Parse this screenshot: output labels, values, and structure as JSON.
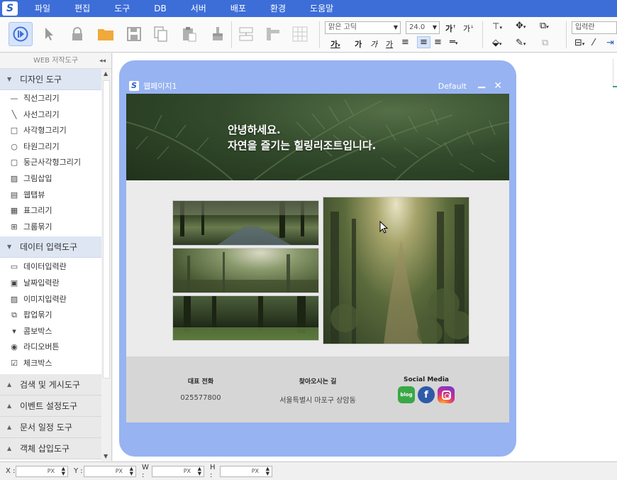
{
  "menubar": {
    "items": [
      "파일",
      "편집",
      "도구",
      "DB",
      "서버",
      "배포",
      "환경",
      "도움말"
    ]
  },
  "toolbar": {
    "font_name": "맑은 고딕",
    "font_size": "24.0",
    "input_label": "입력란"
  },
  "sidebar": {
    "title": "WEB 저작도구",
    "design_header": "디자인 도구",
    "design_items": [
      {
        "label": "직선그리기",
        "icon": "line-icon"
      },
      {
        "label": "사선그리기",
        "icon": "diagonal-line-icon"
      },
      {
        "label": "사각형그리기",
        "icon": "rectangle-icon"
      },
      {
        "label": "타원그리기",
        "icon": "ellipse-icon"
      },
      {
        "label": "둥근사각형그리기",
        "icon": "rounded-rectangle-icon"
      },
      {
        "label": "그림삽입",
        "icon": "image-icon"
      },
      {
        "label": "웹탭뷰",
        "icon": "web-tab-icon"
      },
      {
        "label": "표그리기",
        "icon": "table-icon"
      },
      {
        "label": "그룹묶기",
        "icon": "group-icon"
      }
    ],
    "data_header": "데이터 입력도구",
    "data_items": [
      {
        "label": "데이터입력란",
        "icon": "data-input-icon"
      },
      {
        "label": "날짜입력란",
        "icon": "date-input-icon"
      },
      {
        "label": "이미지입력란",
        "icon": "image-input-icon"
      },
      {
        "label": "팝업묶기",
        "icon": "popup-icon"
      },
      {
        "label": "콤보박스",
        "icon": "combobox-icon"
      },
      {
        "label": "라디오버튼",
        "icon": "radio-icon"
      },
      {
        "label": "체크박스",
        "icon": "checkbox-icon"
      }
    ],
    "closed_sections": [
      "검색 및 게시도구",
      "이벤트 설정도구",
      "문서 일정 도구",
      "객체 삽입도구"
    ]
  },
  "window": {
    "title": "웹페이지1",
    "theme": "Default"
  },
  "page": {
    "hero_line1": "안녕하세요.",
    "hero_line2": "자연을 즐기는 힐링리조트입니다.",
    "footer": {
      "phone_title": "대표 전화",
      "phone_value": "025577800",
      "location_title": "찾아오시는 길",
      "location_value": "서울특별시 마포구 상암동",
      "social_title": "Social Media",
      "blog_label": "blog"
    }
  },
  "statusbar": {
    "fields": [
      {
        "label": "X :",
        "unit": "PX"
      },
      {
        "label": "Y :",
        "unit": "PX"
      },
      {
        "label": "W :",
        "unit": "PX"
      },
      {
        "label": "H :",
        "unit": "PX"
      }
    ]
  },
  "colors": {
    "menubar": "#3d6ed8",
    "frame": "#97b3f1",
    "accent": "#2c5cc6"
  }
}
